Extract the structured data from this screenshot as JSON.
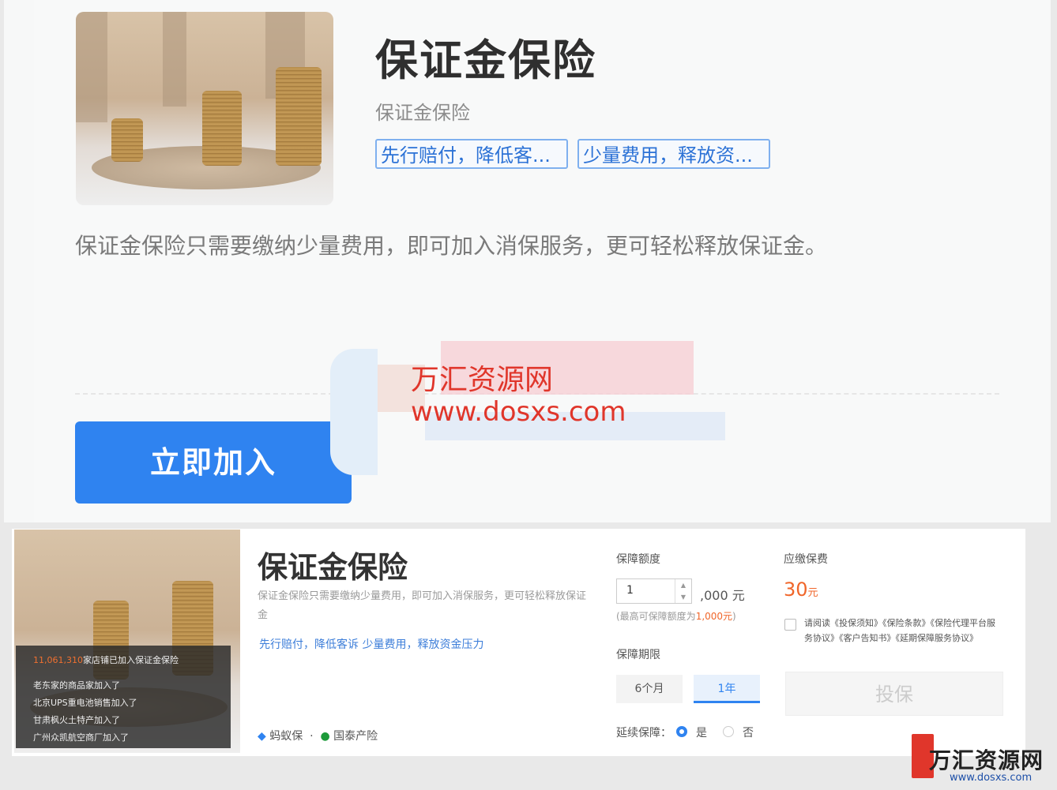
{
  "hero": {
    "title": "保证金保险",
    "subtitle": "保证金保险",
    "tags": [
      "先行赔付，降低客...",
      "少量费用，释放资..."
    ],
    "description": "保证金保险只需要缴纳少量费用，即可加入消保服务，更可轻松释放保证金。",
    "join_button": "立即加入"
  },
  "watermark": {
    "name": "万汇资源网",
    "url": "www.dosxs.com",
    "logo_name": "万汇资源网",
    "logo_url": "www.dosxs.com"
  },
  "product": {
    "title": "保证金保险",
    "description": "保证金保险只需要缴纳少量费用，即可加入消保服务，更可轻松释放保证金",
    "tags": "先行赔付，降低客诉  少量费用，释放资金压力",
    "ticker": {
      "headline_count": "11,061,310",
      "headline_text": "家店铺已加入保证金保险",
      "items": [
        "老东家的商品家加入了",
        "北京UPS重电池销售加入了",
        "甘肃枫火土特产加入了",
        "广州众凯航空商厂加入了"
      ]
    },
    "brand_logos": [
      "蚂蚁保",
      "国泰产险"
    ],
    "coverage_label": "保障额度",
    "coverage_value": "1",
    "coverage_unit": ",000 元",
    "coverage_hint_prefix": "(最高可保障额度为",
    "coverage_hint_max": "1,000元",
    "coverage_hint_suffix": ")",
    "period_label": "保障期限",
    "period_options": [
      "6个月",
      "1年"
    ],
    "renew_label": "延续保障：",
    "renew_options": [
      "是",
      "否"
    ],
    "fee_label": "应缴保费",
    "fee_value": "30",
    "fee_unit": "元",
    "agreement": "请阅读《投保须知》《保险条款》《保险代理平台服务协议》《客户告知书》《延期保障服务协议》",
    "buy_button": "投保"
  },
  "colors": {
    "primary": "#2f83f0",
    "tag_blue": "#2c72d6",
    "fee_orange": "#f0662a",
    "watermark_red": "#e0362b"
  }
}
